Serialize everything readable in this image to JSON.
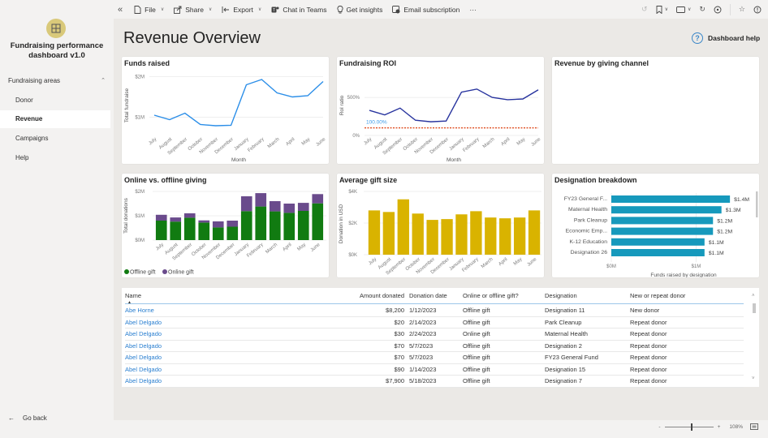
{
  "sidebar": {
    "collapse_icon": "«",
    "app_title": "Fundraising performance dashboard v1.0",
    "group_label": "Fundraising areas",
    "items": [
      {
        "label": "Donor",
        "active": false
      },
      {
        "label": "Revenue",
        "active": true
      },
      {
        "label": "Campaigns",
        "active": false
      },
      {
        "label": "Help",
        "active": false
      }
    ],
    "go_back": "Go back"
  },
  "toolbar": {
    "collapse_icon": "«",
    "file": "File",
    "share": "Share",
    "export": "Export",
    "chat_in_teams": "Chat in Teams",
    "get_insights": "Get insights",
    "email_subscription": "Email subscription",
    "more": "···"
  },
  "header": {
    "title": "Revenue Overview",
    "help_label": "Dashboard help"
  },
  "colors": {
    "funds_line": "#2b8ee8",
    "roi_line": "#27339e",
    "roi_threshold": "#e0562b",
    "offline": "#117b11",
    "online": "#6a4b8c",
    "avg_gift": "#d9b300",
    "designation": "#1699bc",
    "link": "#2a7fd0"
  },
  "chart_data": [
    {
      "id": "funds_raised",
      "type": "line",
      "title": "Funds raised",
      "xlabel": "Month",
      "ylabel": "Total fundraise",
      "categories": [
        "July",
        "August",
        "September",
        "October",
        "November",
        "December",
        "January",
        "February",
        "March",
        "April",
        "May",
        "June"
      ],
      "values": [
        1.05,
        0.94,
        1.1,
        0.82,
        0.79,
        0.8,
        1.8,
        1.93,
        1.6,
        1.5,
        1.53,
        1.88
      ],
      "unit": "$M",
      "yticks": [
        {
          "v": 1,
          "label": "$1M"
        },
        {
          "v": 2,
          "label": "$2M"
        }
      ],
      "ylim": [
        0.55,
        2.05
      ],
      "grid": true
    },
    {
      "id": "fundraising_roi",
      "type": "line",
      "title": "Fundraising ROI",
      "xlabel": "Month",
      "ylabel": "RoI ratio",
      "categories": [
        "July",
        "August",
        "September",
        "October",
        "November",
        "December",
        "January",
        "February",
        "March",
        "April",
        "May",
        "June"
      ],
      "values": [
        330,
        270,
        360,
        200,
        180,
        190,
        570,
        610,
        500,
        470,
        480,
        600
      ],
      "unit": "%",
      "threshold": {
        "value": 100,
        "label": "100.00%"
      },
      "yticks": [
        {
          "v": 0,
          "label": "0%"
        },
        {
          "v": 500,
          "label": "500%"
        }
      ],
      "ylim": [
        0,
        800
      ],
      "grid": true
    },
    {
      "id": "revenue_by_channel",
      "type": "table",
      "title": "Revenue by giving channel"
    },
    {
      "id": "online_offline",
      "type": "bar",
      "stacked": true,
      "title": "Online vs. offline giving",
      "ylabel": "Total donations",
      "categories": [
        "July",
        "August",
        "September",
        "October",
        "November",
        "December",
        "January",
        "February",
        "March",
        "April",
        "May",
        "June"
      ],
      "series": [
        {
          "name": "Offline gift",
          "values": [
            0.8,
            0.76,
            0.92,
            0.72,
            0.52,
            0.55,
            1.19,
            1.38,
            1.18,
            1.12,
            1.2,
            1.51
          ]
        },
        {
          "name": "Online gift",
          "values": [
            0.24,
            0.17,
            0.18,
            0.09,
            0.25,
            0.25,
            0.61,
            0.55,
            0.42,
            0.38,
            0.33,
            0.38
          ]
        }
      ],
      "unit": "$M",
      "yticks": [
        {
          "v": 0,
          "label": "$0M"
        },
        {
          "v": 1,
          "label": "$1M"
        },
        {
          "v": 2,
          "label": "$2M"
        }
      ],
      "ylim": [
        0,
        2
      ],
      "legend": "bottom-left",
      "grid": true
    },
    {
      "id": "avg_gift_size",
      "type": "bar",
      "title": "Average gift size",
      "ylabel": "Donation in USD",
      "categories": [
        "July",
        "August",
        "September",
        "October",
        "November",
        "December",
        "January",
        "February",
        "March",
        "April",
        "May",
        "June"
      ],
      "values": [
        2.8,
        2.7,
        3.5,
        2.6,
        2.2,
        2.25,
        2.55,
        2.75,
        2.35,
        2.3,
        2.35,
        2.8
      ],
      "unit": "$K",
      "yticks": [
        {
          "v": 0,
          "label": "$0K"
        },
        {
          "v": 2,
          "label": "$2K"
        },
        {
          "v": 4,
          "label": "$4K"
        }
      ],
      "ylim": [
        0,
        4
      ],
      "grid": true
    },
    {
      "id": "designation_breakdown",
      "type": "bar",
      "orientation": "horizontal",
      "title": "Designation breakdown",
      "xlabel": "Funds raised by designation",
      "categories": [
        "FY23 General F...",
        "Maternal Health",
        "Park Cleanup",
        "Economic Emp...",
        "K-12 Education",
        "Designation 26"
      ],
      "values": [
        1.4,
        1.3,
        1.2,
        1.2,
        1.1,
        1.1
      ],
      "labels": [
        "$1.4M",
        "$1.3M",
        "$1.2M",
        "$1.2M",
        "$1.1M",
        "$1.1M"
      ],
      "unit": "$M",
      "xticks": [
        {
          "v": 0,
          "label": "$0M"
        },
        {
          "v": 1,
          "label": "$1M"
        }
      ],
      "xlim": [
        0,
        1.6
      ],
      "grid": true
    }
  ],
  "table": {
    "columns": [
      "Name",
      "Amount donated",
      "Donation date",
      "Online or offline gift?",
      "Designation",
      "New or repeat donor"
    ],
    "sort_indicator": "▲",
    "rows": [
      [
        "Abe Horne",
        "$8,200",
        "1/12/2023",
        "Offline gift",
        "Designation 11",
        "New donor"
      ],
      [
        "Abel Delgado",
        "$20",
        "2/14/2023",
        "Offline gift",
        "Park Cleanup",
        "Repeat donor"
      ],
      [
        "Abel Delgado",
        "$30",
        "2/24/2023",
        "Online gift",
        "Maternal Health",
        "Repeat donor"
      ],
      [
        "Abel Delgado",
        "$70",
        "5/7/2023",
        "Offline gift",
        "Designation 2",
        "Repeat donor"
      ],
      [
        "Abel Delgado",
        "$70",
        "5/7/2023",
        "Offline gift",
        "FY23 General Fund",
        "Repeat donor"
      ],
      [
        "Abel Delgado",
        "$90",
        "1/14/2023",
        "Offline gift",
        "Designation 15",
        "Repeat donor"
      ],
      [
        "Abel Delgado",
        "$7,900",
        "5/18/2023",
        "Offline gift",
        "Designation 7",
        "Repeat donor"
      ]
    ]
  },
  "statusbar": {
    "zoom_minus": "-",
    "zoom_plus": "+",
    "zoom_level": "108%"
  }
}
